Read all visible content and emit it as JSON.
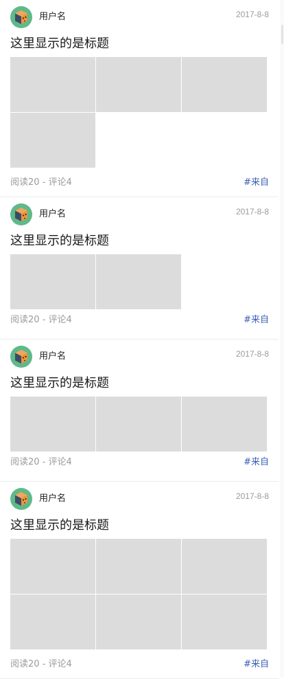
{
  "posts": [
    {
      "username": "用户名",
      "date": "2017-8-8",
      "title": "这里显示的是标题",
      "image_count": 4,
      "stats": "阅读20 - 评论4",
      "source": "#来自"
    },
    {
      "username": "用户名",
      "date": "2017-8-8",
      "title": "这里显示的是标题",
      "image_count": 2,
      "stats": "阅读20 - 评论4",
      "source": "#来自"
    },
    {
      "username": "用户名",
      "date": "2017-8-8",
      "title": "这里显示的是标题",
      "image_count": 3,
      "stats": "阅读20 - 评论4",
      "source": "#来自"
    },
    {
      "username": "用户名",
      "date": "2017-8-8",
      "title": "这里显示的是标题",
      "image_count": 6,
      "stats": "阅读20 - 评论4",
      "source": "#来自"
    }
  ],
  "icons": {
    "avatar": "robot-avatar-icon"
  },
  "colors": {
    "avatar_ring": "#5fb98a",
    "thumb": "#dcdcdc",
    "source_link": "#3a5fb5",
    "muted_text": "#9a9a9a"
  }
}
